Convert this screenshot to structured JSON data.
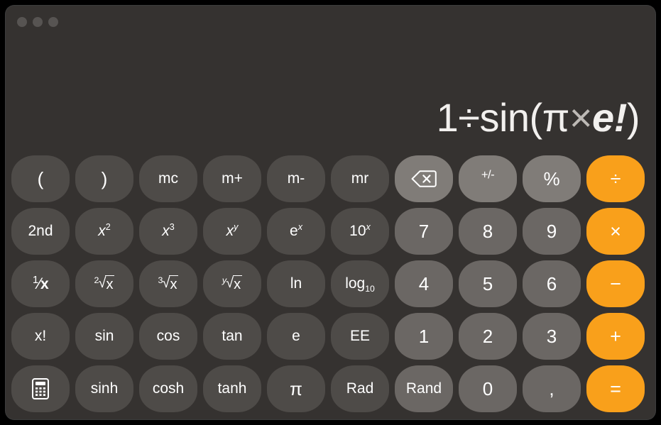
{
  "window": {
    "title": "",
    "traffic_lights": [
      "close",
      "minimize",
      "zoom"
    ],
    "background_color": "#353230"
  },
  "display": {
    "expression": "1÷sin(π×e!)",
    "parts": [
      {
        "text": "1",
        "style": "normal"
      },
      {
        "text": "÷",
        "style": "normal"
      },
      {
        "text": "sin(",
        "style": "normal"
      },
      {
        "text": "π",
        "style": "normal"
      },
      {
        "text": "×",
        "style": "dim"
      },
      {
        "text": "e",
        "style": "italic-bold"
      },
      {
        "text": "!",
        "style": "italic-bold"
      },
      {
        "text": ")",
        "style": "normal"
      }
    ],
    "text_color": "#f2f0ee"
  },
  "colors": {
    "function_key": "#4e4b48",
    "number_key": "#6b6764",
    "utility_key": "#807c78",
    "operator_key": "#f9a01b",
    "label": "#ffffff"
  },
  "keypad": {
    "rows": [
      [
        {
          "label": "(",
          "name": "open-paren",
          "type": "fn"
        },
        {
          "label": ")",
          "name": "close-paren",
          "type": "fn"
        },
        {
          "label": "mc",
          "name": "memory-clear",
          "type": "fn"
        },
        {
          "label": "m+",
          "name": "memory-add",
          "type": "fn"
        },
        {
          "label": "m-",
          "name": "memory-subtract",
          "type": "fn"
        },
        {
          "label": "mr",
          "name": "memory-recall",
          "type": "fn"
        },
        {
          "label": "",
          "name": "delete",
          "type": "util",
          "icon": "delete-backspace-icon"
        },
        {
          "label": "+/-",
          "name": "sign-toggle",
          "type": "util"
        },
        {
          "label": "%",
          "name": "percent",
          "type": "util"
        },
        {
          "label": "÷",
          "name": "divide",
          "type": "op"
        }
      ],
      [
        {
          "label": "2nd",
          "name": "second-function",
          "type": "fn"
        },
        {
          "label": "x2",
          "name": "x-squared",
          "type": "fn"
        },
        {
          "label": "x3",
          "name": "x-cubed",
          "type": "fn"
        },
        {
          "label": "xy",
          "name": "x-to-the-y",
          "type": "fn"
        },
        {
          "label": "ex",
          "name": "e-to-the-x",
          "type": "fn"
        },
        {
          "label": "10x",
          "name": "ten-to-the-x",
          "type": "fn"
        },
        {
          "label": "7",
          "name": "digit-7",
          "type": "num"
        },
        {
          "label": "8",
          "name": "digit-8",
          "type": "num"
        },
        {
          "label": "9",
          "name": "digit-9",
          "type": "num"
        },
        {
          "label": "×",
          "name": "multiply",
          "type": "op"
        }
      ],
      [
        {
          "label": "1/x",
          "name": "reciprocal",
          "type": "fn"
        },
        {
          "label": "2√x",
          "name": "square-root",
          "type": "fn"
        },
        {
          "label": "3√x",
          "name": "cube-root",
          "type": "fn"
        },
        {
          "label": "y√x",
          "name": "y-root-of-x",
          "type": "fn"
        },
        {
          "label": "ln",
          "name": "natural-log",
          "type": "fn"
        },
        {
          "label": "log10",
          "name": "log-base-10",
          "type": "fn"
        },
        {
          "label": "4",
          "name": "digit-4",
          "type": "num"
        },
        {
          "label": "5",
          "name": "digit-5",
          "type": "num"
        },
        {
          "label": "6",
          "name": "digit-6",
          "type": "num"
        },
        {
          "label": "−",
          "name": "subtract",
          "type": "op"
        }
      ],
      [
        {
          "label": "x!",
          "name": "factorial",
          "type": "fn"
        },
        {
          "label": "sin",
          "name": "sine",
          "type": "fn"
        },
        {
          "label": "cos",
          "name": "cosine",
          "type": "fn"
        },
        {
          "label": "tan",
          "name": "tangent",
          "type": "fn"
        },
        {
          "label": "e",
          "name": "euler-number",
          "type": "fn"
        },
        {
          "label": "EE",
          "name": "exponent-entry",
          "type": "fn"
        },
        {
          "label": "1",
          "name": "digit-1",
          "type": "num"
        },
        {
          "label": "2",
          "name": "digit-2",
          "type": "num"
        },
        {
          "label": "3",
          "name": "digit-3",
          "type": "num"
        },
        {
          "label": "+",
          "name": "add",
          "type": "op"
        }
      ],
      [
        {
          "label": "",
          "name": "calculator-mode",
          "type": "fn",
          "icon": "calculator-icon"
        },
        {
          "label": "sinh",
          "name": "hyperbolic-sine",
          "type": "fn"
        },
        {
          "label": "cosh",
          "name": "hyperbolic-cosine",
          "type": "fn"
        },
        {
          "label": "tanh",
          "name": "hyperbolic-tangent",
          "type": "fn"
        },
        {
          "label": "π",
          "name": "pi",
          "type": "fn"
        },
        {
          "label": "Rad",
          "name": "radians-mode",
          "type": "fn"
        },
        {
          "label": "Rand",
          "name": "random",
          "type": "num"
        },
        {
          "label": "0",
          "name": "digit-0",
          "type": "num"
        },
        {
          "label": ",",
          "name": "decimal-separator",
          "type": "num"
        },
        {
          "label": "=",
          "name": "equals",
          "type": "op"
        }
      ]
    ]
  },
  "labels": {
    "r0": {
      "c0": "(",
      "c1": ")",
      "c2": "mc",
      "c3": "m+",
      "c4": "m-",
      "c5": "mr",
      "c7": "+/-",
      "c8": "%",
      "c9": "÷"
    },
    "r1": {
      "c0": "2nd",
      "c1base": "x",
      "c1sup": "2",
      "c2base": "x",
      "c2sup": "3",
      "c3base": "x",
      "c3sup": "y",
      "c4base": "e",
      "c4sup": "x",
      "c5base": "10",
      "c5sup": "x",
      "c6": "7",
      "c7": "8",
      "c8": "9",
      "c9": "×"
    },
    "r2": {
      "c0n": "1",
      "c0slash": "⁄",
      "c0d": "x",
      "c1idx": "2",
      "c1rad": "x",
      "c2idx": "3",
      "c2rad": "x",
      "c3idx": "y",
      "c3rad": "x",
      "c4": "ln",
      "c5base": "log",
      "c5sub": "10",
      "c6": "4",
      "c7": "5",
      "c8": "6",
      "c9": "−"
    },
    "r3": {
      "c0": "x!",
      "c1": "sin",
      "c2": "cos",
      "c3": "tan",
      "c4": "e",
      "c5": "EE",
      "c6": "1",
      "c7": "2",
      "c8": "3",
      "c9": "+"
    },
    "r4": {
      "c1": "sinh",
      "c2": "cosh",
      "c3": "tanh",
      "c4": "π",
      "c5": "Rad",
      "c6": "Rand",
      "c7": "0",
      "c8": ",",
      "c9": "="
    }
  }
}
